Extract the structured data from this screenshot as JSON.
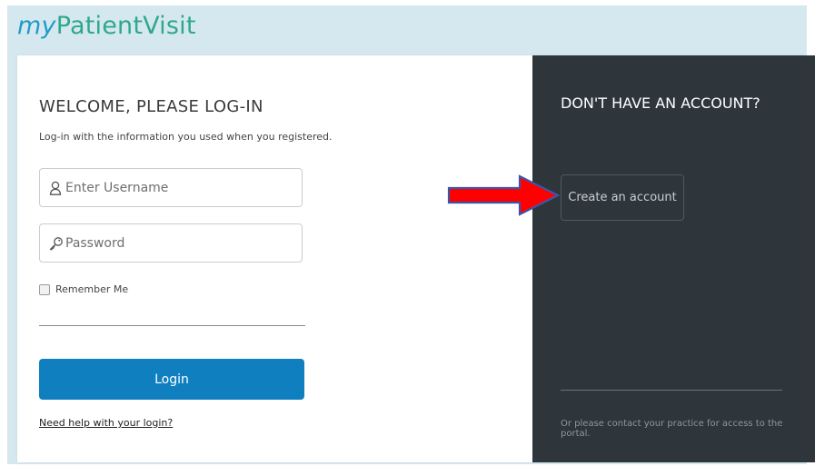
{
  "brand": {
    "prefix": "my",
    "name": "PatientVisit"
  },
  "login": {
    "heading": "WELCOME, PLEASE LOG-IN",
    "subtitle": "Log-in with the information you used when you registered.",
    "username_placeholder": "Enter Username",
    "password_placeholder": "Password",
    "remember_label": "Remember Me",
    "login_button": "Login",
    "help_link": "Need help with your login?"
  },
  "signup": {
    "heading": "DON'T HAVE AN ACCOUNT?",
    "create_button": "Create an account",
    "contact_text": "Or please contact your practice for access to the portal."
  },
  "icons": {
    "username": "user-icon",
    "password": "key-icon",
    "arrow": "red-arrow-right"
  },
  "colors": {
    "brand_green": "#2fa88d",
    "brand_blue": "#1f9cc8",
    "login_button": "#0f7fc0",
    "dark_panel": "#2e363c",
    "arrow_red": "#ff0000"
  }
}
